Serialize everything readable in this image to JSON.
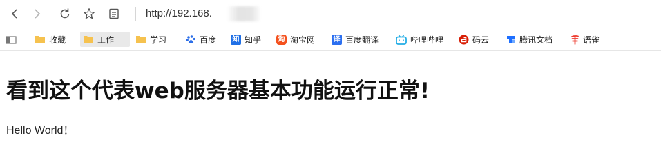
{
  "toolbar": {
    "back_icon": "chevron-left-icon",
    "forward_icon": "chevron-right-icon",
    "reload_icon": "reload-icon",
    "favorite_icon": "star-icon",
    "reader_icon": "reader-mode-icon",
    "url_text": "http://192.168."
  },
  "bookmarks": {
    "toggle_icon": "sidebar-toggle-icon",
    "items": [
      {
        "label": "收藏",
        "icon": "folder-icon"
      },
      {
        "label": "工作",
        "icon": "folder-icon"
      },
      {
        "label": "学习",
        "icon": "folder-icon"
      },
      {
        "label": "百度",
        "icon": "baidu-icon"
      },
      {
        "label": "知乎",
        "icon": "zhihu-icon"
      },
      {
        "label": "淘宝网",
        "icon": "taobao-icon"
      },
      {
        "label": "百度翻译",
        "icon": "baidu-translate-icon"
      },
      {
        "label": "哔哩哔哩",
        "icon": "bilibili-icon"
      },
      {
        "label": "码云",
        "icon": "gitee-icon"
      },
      {
        "label": "腾讯文档",
        "icon": "tencent-docs-icon"
      },
      {
        "label": "语雀",
        "icon": "yuque-icon"
      }
    ]
  },
  "page": {
    "heading": "看到这个代表web服务器基本功能运行正常!",
    "body": "Hello World！"
  },
  "colors": {
    "folder": "#f6c24f",
    "baidu": "#2d6fe8",
    "zhihu": "#1f6fe5",
    "taobao": "#f4511e",
    "baidu_translate": "#2b6ff0",
    "bilibili": "#23ade5",
    "gitee": "#d81e06",
    "tencent_docs": "#1e6fff",
    "yuque": "#ee3b2f"
  }
}
